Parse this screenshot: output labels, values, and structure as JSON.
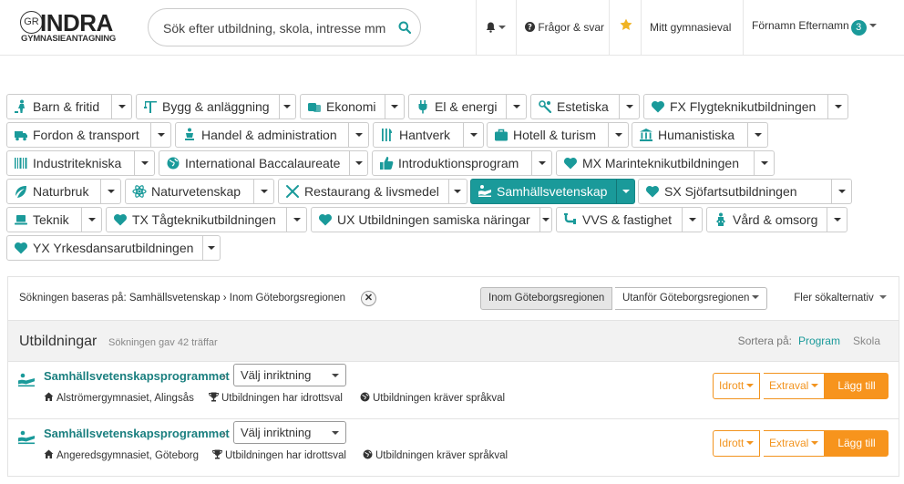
{
  "header": {
    "logo_word": "INDRA",
    "logo_mark": "GR",
    "logo_sub": "GYMNASIEANTAGNING",
    "search_placeholder": "Sök efter utbildning, skola, intresse mm",
    "faq_label": "Frågor & svar",
    "mitt_label": "Mitt gymnasieval",
    "user_name": "Förnamn Efternamn",
    "user_badge": "3"
  },
  "categories": [
    {
      "label": "Barn & fritid",
      "icon": "child-icon",
      "active": false
    },
    {
      "label": "Bygg & anläggning",
      "icon": "crane-icon",
      "active": false
    },
    {
      "label": "Ekonomi",
      "icon": "money-icon",
      "active": false
    },
    {
      "label": "El & energi",
      "icon": "plug-icon",
      "active": false
    },
    {
      "label": "Estetiska",
      "icon": "paint-icon",
      "active": false
    },
    {
      "label": "FX Flygteknikutbildningen",
      "icon": "heart-icon",
      "active": false
    },
    {
      "label": "Fordon & transport",
      "icon": "truck-icon",
      "active": false
    },
    {
      "label": "Handel & administration",
      "icon": "cart-icon",
      "active": false
    },
    {
      "label": "Hantverk",
      "icon": "tools-icon",
      "active": false
    },
    {
      "label": "Hotell & turism",
      "icon": "suitcase-icon",
      "active": false
    },
    {
      "label": "Humanistiska",
      "icon": "institution-icon",
      "active": false
    },
    {
      "label": "Industritekniska",
      "icon": "barcode-icon",
      "active": false
    },
    {
      "label": "International Baccalaureate",
      "icon": "globe-icon",
      "active": false
    },
    {
      "label": "Introduktionsprogram",
      "icon": "thumbs-up-icon",
      "active": false
    },
    {
      "label": "MX Marinteknikutbildningen",
      "icon": "heart-icon",
      "active": false
    },
    {
      "label": "Naturbruk",
      "icon": "leaf-icon",
      "active": false
    },
    {
      "label": "Naturvetenskap",
      "icon": "atom-icon",
      "active": false
    },
    {
      "label": "Restaurang & livsmedel",
      "icon": "cutlery-icon",
      "active": false
    },
    {
      "label": "Samhällsvetenskap",
      "icon": "reading-icon",
      "active": true
    },
    {
      "label": "SX Sjöfartsutbildningen",
      "icon": "heart-icon",
      "active": false
    },
    {
      "label": "Teknik",
      "icon": "laptop-icon",
      "active": false
    },
    {
      "label": "TX Tågteknikutbildningen",
      "icon": "heart-icon",
      "active": false
    },
    {
      "label": "UX Utbildningen samiska näringar",
      "icon": "heart-icon",
      "active": false
    },
    {
      "label": "VVS & fastighet",
      "icon": "pipe-icon",
      "active": false
    },
    {
      "label": "Vård & omsorg",
      "icon": "care-icon",
      "active": false
    },
    {
      "label": "YX Yrkesdansarutbildningen",
      "icon": "heart-icon",
      "active": false
    }
  ],
  "filter": {
    "text": "Sökningen baseras på: Samhällsvetenskap › Inom Göteborgsregionen",
    "inside_label": "Inom Göteborgsregionen",
    "outside_label": "Utanför Göteborgsregionen",
    "more_label": "Fler sökalternativ"
  },
  "results": {
    "title": "Utbildningar",
    "count_text": "Sökningen gav 42 träffar",
    "sort_label": "Sortera på:",
    "sort_program": "Program",
    "sort_school": "Skola",
    "rows": [
      {
        "program": "Samhällsvetenskapsprogrammet",
        "select": "Välj inriktning",
        "school": "Alströmergymnasiet, Alingsås",
        "sport": "Utbildningen har idrottsval",
        "language": "Utbildningen kräver språkval",
        "btn_sport": "Idrott",
        "btn_extra": "Extraval",
        "btn_add": "Lägg till"
      },
      {
        "program": "Samhällsvetenskapsprogrammet",
        "select": "Välj inriktning",
        "school": "Angeredsgymnasiet, Göteborg",
        "sport": "Utbildningen har idrottsval",
        "language": "Utbildningen kräver språkval",
        "btn_sport": "Idrott",
        "btn_extra": "Extraval",
        "btn_add": "Lägg till"
      }
    ]
  },
  "colors": {
    "accent": "#1a9a9a",
    "orange": "#f7941d"
  }
}
